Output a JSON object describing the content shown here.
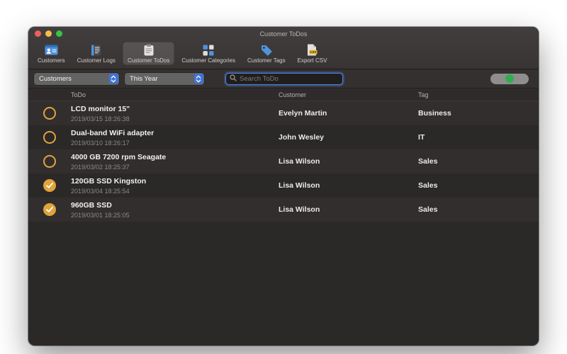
{
  "window": {
    "title": "Customer ToDos"
  },
  "toolbar": {
    "items": [
      {
        "label": "Customers",
        "icon": "customers-icon",
        "selected": false
      },
      {
        "label": "Customer Logs",
        "icon": "customer-logs-icon",
        "selected": false
      },
      {
        "label": "Customer ToDos",
        "icon": "customer-todos-icon",
        "selected": true
      },
      {
        "label": "Customer Categories",
        "icon": "customer-categories-icon",
        "selected": false
      },
      {
        "label": "Customer Tags",
        "icon": "customer-tags-icon",
        "selected": false
      },
      {
        "label": "Export CSV",
        "icon": "export-csv-icon",
        "selected": false
      }
    ]
  },
  "filters": {
    "customer_filter": "Customers",
    "period_filter": "This Year",
    "search_placeholder": "Search ToDo",
    "toggle_on": true
  },
  "table": {
    "columns": [
      "ToDo",
      "Customer",
      "Tag"
    ],
    "rows": [
      {
        "todo": "LCD monitor 15\"",
        "date": "2019/03/15 18:26:38",
        "customer": "Evelyn Martin",
        "tag": "Business",
        "done": false
      },
      {
        "todo": "Dual-band WiFi adapter",
        "date": "2019/03/10 18:26:17",
        "customer": "John Wesley",
        "tag": "IT",
        "done": false
      },
      {
        "todo": "4000 GB 7200 rpm Seagate",
        "date": "2019/03/02 18:25:37",
        "customer": "Lisa Wilson",
        "tag": "Sales",
        "done": false
      },
      {
        "todo": "120GB SSD Kingston",
        "date": "2019/03/04 18:25:54",
        "customer": "Lisa Wilson",
        "tag": "Sales",
        "done": true
      },
      {
        "todo": "960GB SSD",
        "date": "2019/03/01 18:25:05",
        "customer": "Lisa Wilson",
        "tag": "Sales",
        "done": true
      }
    ]
  },
  "colors": {
    "accent_orange": "#e0a33c",
    "toggle_green": "#2fae4e",
    "popup_accent": "#3f74d9",
    "focus_ring": "#4c82dd"
  }
}
